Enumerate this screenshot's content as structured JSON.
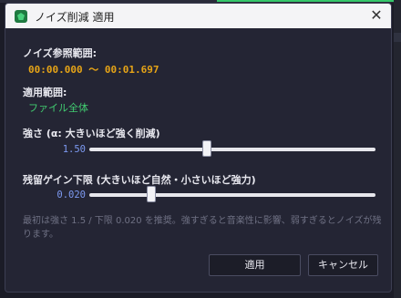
{
  "window": {
    "title": "ノイズ削減 適用",
    "close_glyph": "✕",
    "icon": "app-gem-icon"
  },
  "noise_ref": {
    "label": "ノイズ参照範囲:",
    "range_text": "00:00.000 〜 00:01.697"
  },
  "apply_range": {
    "label": "適用範囲:",
    "value": "ファイル全体"
  },
  "strength": {
    "label": "強さ (α: 大きいほど強く削減)",
    "value_text": "1.50",
    "slider_fraction": 0.41
  },
  "floor": {
    "label": "残留ゲイン下限 (大きいほど自然・小さいほど強力)",
    "value_text": "0.020",
    "slider_fraction": 0.215
  },
  "hint": "最初は強さ 1.5 / 下限 0.020 を推奨。強すぎると音楽性に影響、弱すぎるとノイズが残ります。",
  "buttons": {
    "apply": "適用",
    "cancel": "キャンセル"
  },
  "colors": {
    "accent_orange": "#e6a417",
    "accent_green": "#41cc70",
    "value_blue": "#7d9af2",
    "dialog_bg": "#242534"
  }
}
